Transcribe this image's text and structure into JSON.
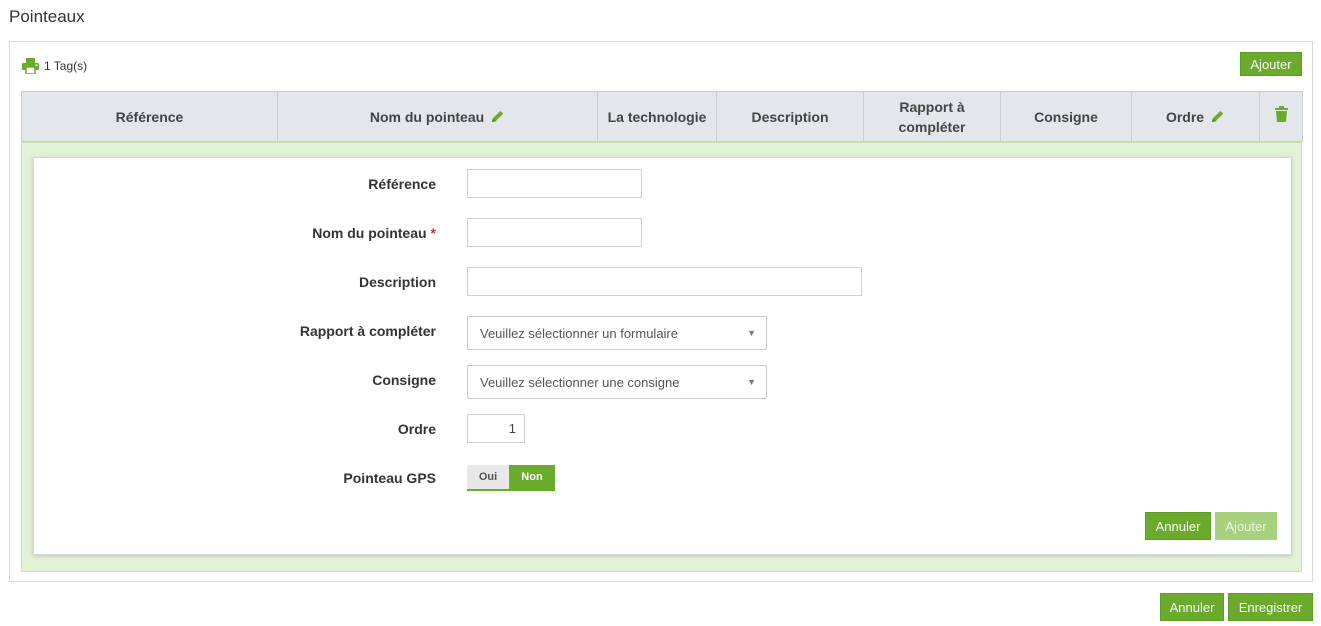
{
  "page": {
    "title": "Pointeaux"
  },
  "toolbar": {
    "tag_count": "1 Tag(s)",
    "add_label": "Ajouter"
  },
  "table": {
    "columns": [
      "Référence",
      "Nom du pointeau",
      "La technologie",
      "Description",
      "Rapport à compléter",
      "Consigne",
      "Ordre"
    ]
  },
  "form": {
    "reference": {
      "label": "Référence",
      "value": ""
    },
    "name": {
      "label": "Nom du pointeau",
      "required_mark": "*",
      "value": ""
    },
    "description": {
      "label": "Description",
      "value": ""
    },
    "report": {
      "label": "Rapport à compléter",
      "selected": "Veuillez sélectionner un formulaire"
    },
    "instruction": {
      "label": "Consigne",
      "selected": "Veuillez sélectionner une consigne"
    },
    "order": {
      "label": "Ordre",
      "value": "1"
    },
    "gps": {
      "label": "Pointeau GPS",
      "options": [
        "Oui",
        "Non"
      ],
      "selected": "Non"
    },
    "cancel_label": "Annuler",
    "add_label": "Ajouter"
  },
  "footer": {
    "cancel_label": "Annuler",
    "save_label": "Enregistrer"
  },
  "colors": {
    "accent": "#6aab2b",
    "header_bg": "#e3e6eb",
    "form_bg": "#e2f2d6"
  }
}
